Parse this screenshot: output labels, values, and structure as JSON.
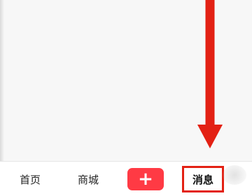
{
  "tabs": {
    "home": "首页",
    "mall": "商城",
    "publish": "+",
    "messages": "消息"
  },
  "icons": {
    "arrow": "down-arrow-icon"
  },
  "colors": {
    "accent_red": "#ff3a44",
    "highlight_red": "#e32114"
  }
}
